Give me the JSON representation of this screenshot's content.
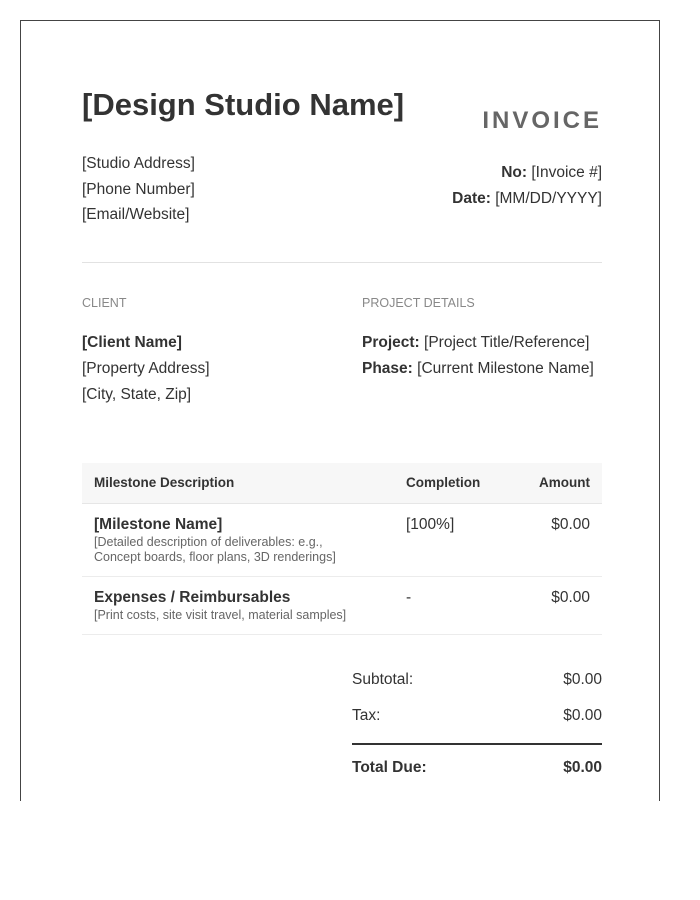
{
  "header": {
    "studio_name": "[Design Studio Name]",
    "doc_label": "INVOICE",
    "studio_address": "[Studio Address]",
    "studio_phone": "[Phone Number]",
    "studio_contact": "[Email/Website]",
    "number_label": "No:",
    "number_value": "[Invoice #]",
    "date_label": "Date:",
    "date_value": "[MM/DD/YYYY]"
  },
  "client": {
    "section_label": "CLIENT",
    "name": "[Client Name]",
    "address": "[Property Address]",
    "city": "[City, State, Zip]"
  },
  "project": {
    "section_label": "PROJECT DETAILS",
    "project_label": "Project:",
    "project_value": "[Project Title/Reference]",
    "phase_label": "Phase:",
    "phase_value": "[Current Milestone Name]"
  },
  "table": {
    "headers": {
      "description": "Milestone Description",
      "completion": "Completion",
      "amount": "Amount"
    },
    "rows": [
      {
        "name": "[Milestone Name]",
        "desc_line1": "[Detailed description of deliverables: e.g.,",
        "desc_line2": "Concept boards, floor plans, 3D renderings]",
        "completion": "[100%]",
        "amount": "$0.00"
      },
      {
        "name": "Expenses / Reimbursables",
        "desc_line1": "[Print costs, site visit travel, material samples]",
        "completion": "-",
        "amount": "$0.00"
      }
    ]
  },
  "totals": {
    "subtotal_label": "Subtotal:",
    "subtotal_value": "$0.00",
    "tax_label": "Tax:",
    "tax_value": "$0.00",
    "total_label": "Total Due:",
    "total_value": "$0.00"
  }
}
